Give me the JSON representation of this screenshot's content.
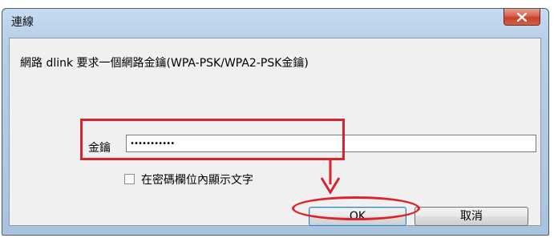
{
  "window": {
    "title": "連線",
    "close_label": "X"
  },
  "dialog": {
    "message": "網路 dlink 要求一個網路金鑰(WPA-PSK/WPA2-PSK金鑰)",
    "key_label": "金鑰",
    "key_value": "•••••••••••",
    "show_characters_label": "在密碼欄位內顯示文字",
    "show_characters_checked": false,
    "ok_label": "OK",
    "cancel_label": "取消"
  },
  "annotations": {
    "color": "#d9232e"
  },
  "colors": {
    "title_bar": "#b9cfe6",
    "close_button": "#c7412b",
    "client_background": "#f0f0f0"
  }
}
